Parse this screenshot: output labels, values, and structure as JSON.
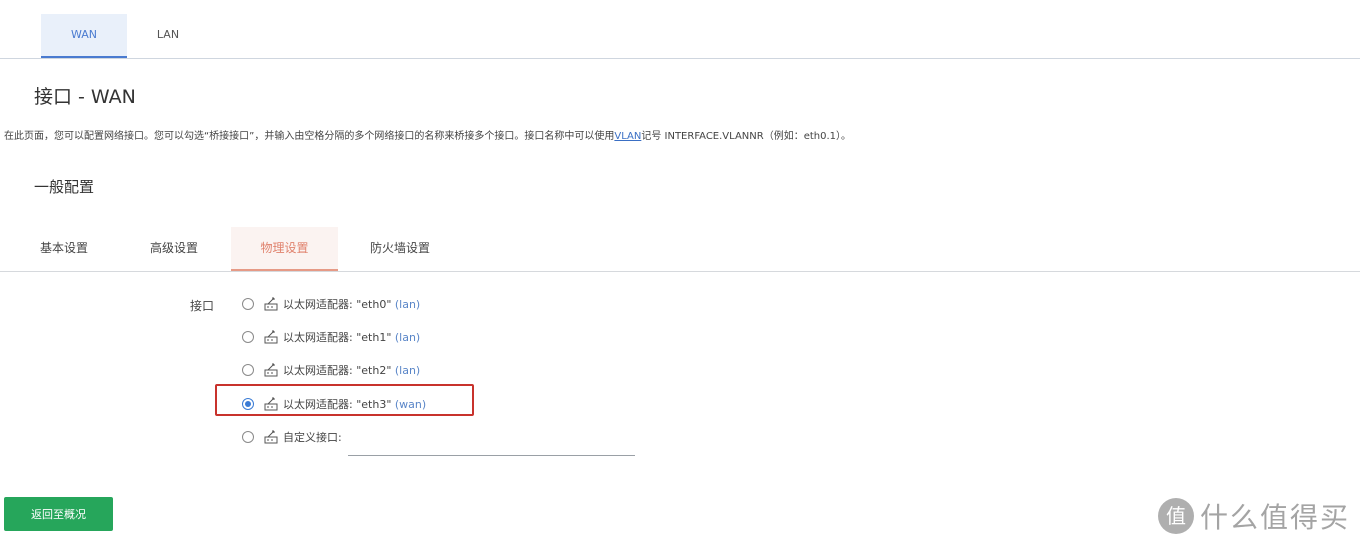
{
  "top_tabs": [
    {
      "label": "WAN",
      "active": true
    },
    {
      "label": "LAN",
      "active": false
    }
  ],
  "page": {
    "title": "接口 - WAN",
    "desc_before": "在此页面，您可以配置网络接口。您可以勾选“桥接接口”，并输入由空格分隔的多个网络接口的名称来桥接多个接口。接口名称中可以使用",
    "desc_link": "VLAN",
    "desc_after": "记号 INTERFACE.VLANNR（例如：eth0.1）。"
  },
  "section_title": "一般配置",
  "sub_tabs": [
    {
      "label": "基本设置",
      "active": false
    },
    {
      "label": "高级设置",
      "active": false
    },
    {
      "label": "物理设置",
      "active": true
    },
    {
      "label": "防火墙设置",
      "active": false
    }
  ],
  "interface_field": {
    "label": "接口",
    "options": [
      {
        "text": "以太网适配器: \"eth0\"",
        "network": "(lan)",
        "checked": false
      },
      {
        "text": "以太网适配器: \"eth1\"",
        "network": "(lan)",
        "checked": false
      },
      {
        "text": "以太网适配器: \"eth2\"",
        "network": "(lan)",
        "checked": false
      },
      {
        "text": "以太网适配器: \"eth3\"",
        "network": "(wan)",
        "checked": true
      },
      {
        "text": "自定义接口:",
        "network": "",
        "checked": false
      }
    ],
    "custom_value": ""
  },
  "back_button_label": "返回至概况",
  "watermark": {
    "badge": "值",
    "text": "什么值得买"
  },
  "colors": {
    "accent_blue": "#4a7bd0",
    "active_subtab": "#e0826d",
    "highlight": "#c8322c",
    "back_button": "#26a65b"
  },
  "icons": {
    "adapter": "ethernet-adapter-icon",
    "radio": "radio-icon"
  }
}
